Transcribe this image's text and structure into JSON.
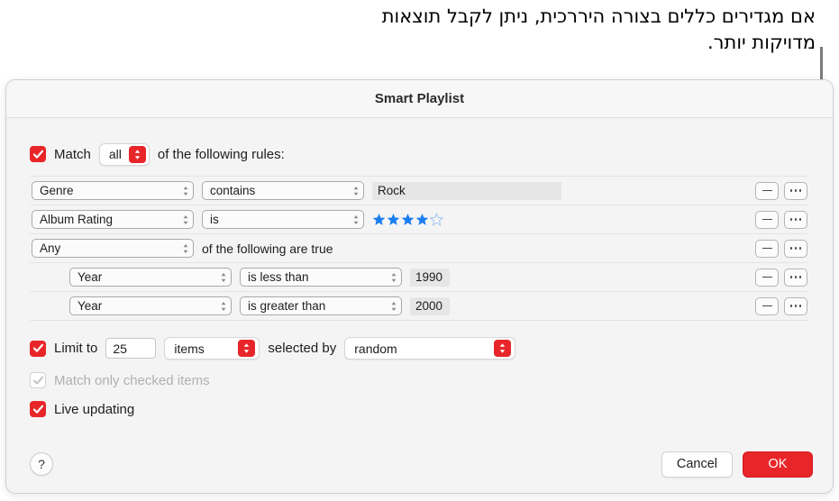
{
  "annotation": {
    "text": "אם מגדירים כללים בצורה היררכית, ניתן לקבל תוצאות מדויקות יותר."
  },
  "dialog": {
    "title": "Smart Playlist"
  },
  "match": {
    "checkbox_checked": true,
    "label": "Match",
    "selector_value": "all",
    "suffix_label": "of the following rules:"
  },
  "rules": [
    {
      "indent": false,
      "field": "Genre",
      "operator": "contains",
      "value_type": "text",
      "value": "Rock",
      "remove_label": "remove-rule",
      "more_label": "more-options"
    },
    {
      "indent": false,
      "field": "Album Rating",
      "operator": "is",
      "value_type": "stars",
      "stars_filled": 4,
      "stars_total": 5,
      "remove_label": "remove-rule",
      "more_label": "more-options"
    },
    {
      "indent": false,
      "field": "Any",
      "value_type": "group",
      "group_text": "of the following are true",
      "remove_label": "remove-rule",
      "more_label": "more-options"
    },
    {
      "indent": true,
      "field": "Year",
      "operator": "is less than",
      "value_type": "year",
      "value": "1990",
      "remove_label": "remove-rule",
      "more_label": "more-options"
    },
    {
      "indent": true,
      "field": "Year",
      "operator": "is greater than",
      "value_type": "year",
      "value": "2000",
      "remove_label": "remove-rule",
      "more_label": "more-options"
    }
  ],
  "options": {
    "limit_checked": true,
    "limit_label": "Limit to",
    "limit_value": "25",
    "limit_unit": "items",
    "selected_by_label": "selected by",
    "selected_by_value": "random",
    "checked_items_checked": true,
    "checked_items_label": "Match only checked items",
    "checked_items_disabled": true,
    "live_updating_checked": true,
    "live_updating_label": "Live updating"
  },
  "footer": {
    "help_label": "?",
    "cancel_label": "Cancel",
    "ok_label": "OK"
  },
  "colors": {
    "accent_red": "#e8262a",
    "star_blue": "#1a7ef0",
    "callout_gray": "#7b7b7b"
  }
}
